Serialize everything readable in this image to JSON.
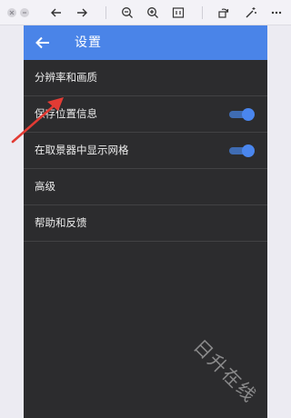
{
  "viewer_toolbar": {
    "buttons": [
      {
        "name": "back-arrow-icon"
      },
      {
        "name": "forward-arrow-icon"
      },
      {
        "name": "zoom-out-icon"
      },
      {
        "name": "zoom-in-icon"
      },
      {
        "name": "fit-to-window-icon"
      },
      {
        "name": "rotate-icon"
      },
      {
        "name": "magic-wand-icon"
      },
      {
        "name": "more-icon"
      }
    ]
  },
  "app": {
    "title": "设置",
    "accent_color": "#4a84e8",
    "toggle_color": "#4a86ee",
    "settings": [
      {
        "label": "分辨率和画质"
      },
      {
        "label": "保存位置信息",
        "toggle": true
      },
      {
        "label": "在取景器中显示网格",
        "toggle": true
      },
      {
        "label": "高级"
      },
      {
        "label": "帮助和反馈"
      }
    ]
  },
  "watermark": "日升在线"
}
